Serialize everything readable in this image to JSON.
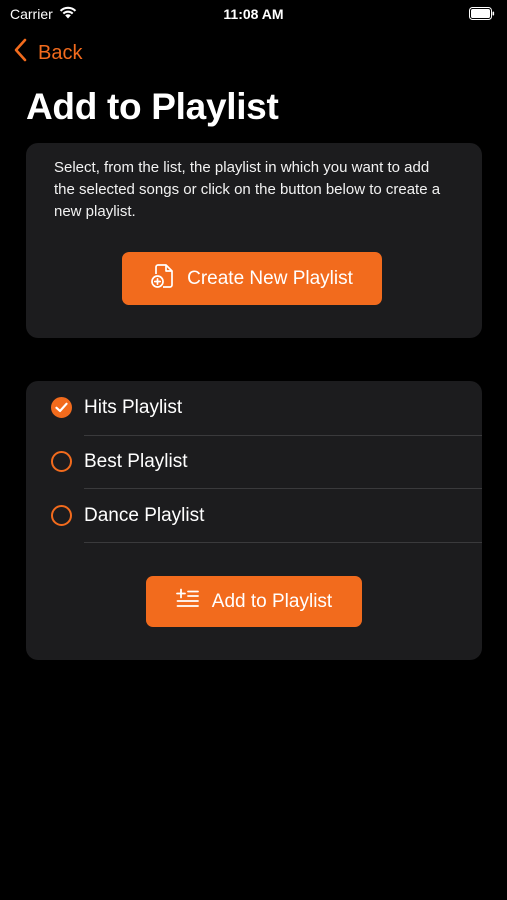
{
  "status_bar": {
    "carrier": "Carrier",
    "time": "11:08 AM",
    "icons": [
      "wifi-icon",
      "battery-icon"
    ]
  },
  "nav": {
    "back_label": "Back",
    "title": "Add to Playlist"
  },
  "intro": {
    "text": "Select, from the list, the playlist in which you want to add the selected songs or click on the button below to create a new playlist.",
    "create_button_label": "Create New Playlist",
    "create_button_icon": "new-document-icon"
  },
  "playlists": {
    "items": [
      {
        "label": "Hits Playlist",
        "selected": true
      },
      {
        "label": "Best Playlist",
        "selected": false
      },
      {
        "label": "Dance Playlist",
        "selected": false
      }
    ],
    "add_button_label": "Add to Playlist",
    "add_button_icon": "add-to-list-icon"
  },
  "colors": {
    "accent": "#f26b1d",
    "background": "#000000",
    "card": "#1c1c1e",
    "divider": "#3a3a3c"
  }
}
